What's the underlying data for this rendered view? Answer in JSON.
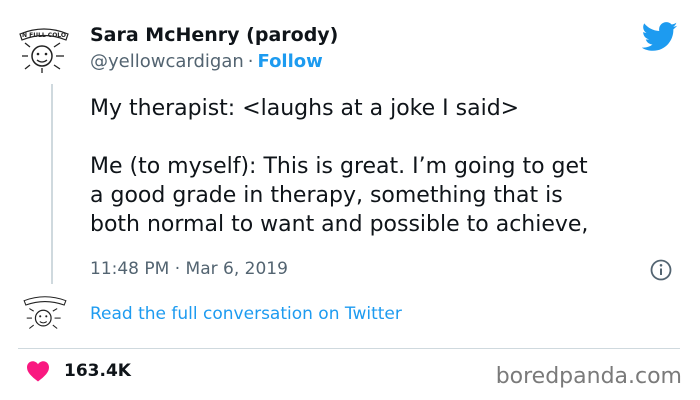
{
  "author": {
    "name": "Sara McHenry (parody)",
    "handle": "@yellowcardigan",
    "separator": "·",
    "follow_label": "Follow",
    "avatar_banner_text": "N FULL COLO",
    "avatar_icon": "cartoon-sun-avatar"
  },
  "tweet": {
    "lines": [
      "My therapist: <laughs at a joke I said>",
      "Me (to myself): This is great. I’m going to get",
      "a good grade in therapy, something that is",
      "both normal to want and possible to achieve,"
    ],
    "timestamp": "11:48 PM · Mar 6, 2019"
  },
  "conversation_link": "Read the full conversation on Twitter",
  "likes": "163.4K",
  "watermark": "boredpanda.com",
  "colors": {
    "accent": "#1d9bf0",
    "heart": "#f91880",
    "text": "#0f1419",
    "muted": "#536471",
    "divider": "#cfd9de"
  },
  "icons": [
    "twitter-bird-icon",
    "info-icon",
    "heart-icon"
  ]
}
